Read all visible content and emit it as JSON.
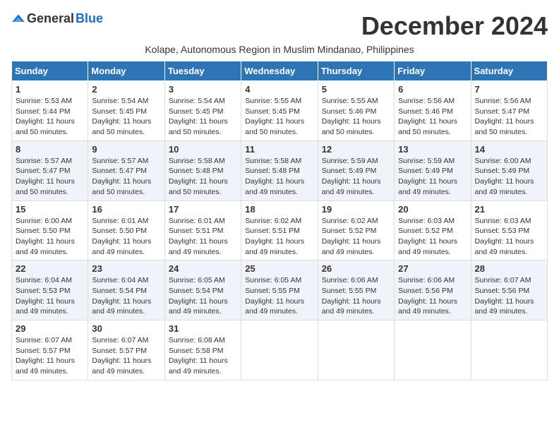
{
  "logo": {
    "general": "General",
    "blue": "Blue"
  },
  "title": "December 2024",
  "subtitle": "Kolape, Autonomous Region in Muslim Mindanao, Philippines",
  "headers": [
    "Sunday",
    "Monday",
    "Tuesday",
    "Wednesday",
    "Thursday",
    "Friday",
    "Saturday"
  ],
  "weeks": [
    [
      {
        "day": "1",
        "info": "Sunrise: 5:53 AM\nSunset: 5:44 PM\nDaylight: 11 hours\nand 50 minutes."
      },
      {
        "day": "2",
        "info": "Sunrise: 5:54 AM\nSunset: 5:45 PM\nDaylight: 11 hours\nand 50 minutes."
      },
      {
        "day": "3",
        "info": "Sunrise: 5:54 AM\nSunset: 5:45 PM\nDaylight: 11 hours\nand 50 minutes."
      },
      {
        "day": "4",
        "info": "Sunrise: 5:55 AM\nSunset: 5:45 PM\nDaylight: 11 hours\nand 50 minutes."
      },
      {
        "day": "5",
        "info": "Sunrise: 5:55 AM\nSunset: 5:46 PM\nDaylight: 11 hours\nand 50 minutes."
      },
      {
        "day": "6",
        "info": "Sunrise: 5:56 AM\nSunset: 5:46 PM\nDaylight: 11 hours\nand 50 minutes."
      },
      {
        "day": "7",
        "info": "Sunrise: 5:56 AM\nSunset: 5:47 PM\nDaylight: 11 hours\nand 50 minutes."
      }
    ],
    [
      {
        "day": "8",
        "info": "Sunrise: 5:57 AM\nSunset: 5:47 PM\nDaylight: 11 hours\nand 50 minutes."
      },
      {
        "day": "9",
        "info": "Sunrise: 5:57 AM\nSunset: 5:47 PM\nDaylight: 11 hours\nand 50 minutes."
      },
      {
        "day": "10",
        "info": "Sunrise: 5:58 AM\nSunset: 5:48 PM\nDaylight: 11 hours\nand 50 minutes."
      },
      {
        "day": "11",
        "info": "Sunrise: 5:58 AM\nSunset: 5:48 PM\nDaylight: 11 hours\nand 49 minutes."
      },
      {
        "day": "12",
        "info": "Sunrise: 5:59 AM\nSunset: 5:49 PM\nDaylight: 11 hours\nand 49 minutes."
      },
      {
        "day": "13",
        "info": "Sunrise: 5:59 AM\nSunset: 5:49 PM\nDaylight: 11 hours\nand 49 minutes."
      },
      {
        "day": "14",
        "info": "Sunrise: 6:00 AM\nSunset: 5:49 PM\nDaylight: 11 hours\nand 49 minutes."
      }
    ],
    [
      {
        "day": "15",
        "info": "Sunrise: 6:00 AM\nSunset: 5:50 PM\nDaylight: 11 hours\nand 49 minutes."
      },
      {
        "day": "16",
        "info": "Sunrise: 6:01 AM\nSunset: 5:50 PM\nDaylight: 11 hours\nand 49 minutes."
      },
      {
        "day": "17",
        "info": "Sunrise: 6:01 AM\nSunset: 5:51 PM\nDaylight: 11 hours\nand 49 minutes."
      },
      {
        "day": "18",
        "info": "Sunrise: 6:02 AM\nSunset: 5:51 PM\nDaylight: 11 hours\nand 49 minutes."
      },
      {
        "day": "19",
        "info": "Sunrise: 6:02 AM\nSunset: 5:52 PM\nDaylight: 11 hours\nand 49 minutes."
      },
      {
        "day": "20",
        "info": "Sunrise: 6:03 AM\nSunset: 5:52 PM\nDaylight: 11 hours\nand 49 minutes."
      },
      {
        "day": "21",
        "info": "Sunrise: 6:03 AM\nSunset: 5:53 PM\nDaylight: 11 hours\nand 49 minutes."
      }
    ],
    [
      {
        "day": "22",
        "info": "Sunrise: 6:04 AM\nSunset: 5:53 PM\nDaylight: 11 hours\nand 49 minutes."
      },
      {
        "day": "23",
        "info": "Sunrise: 6:04 AM\nSunset: 5:54 PM\nDaylight: 11 hours\nand 49 minutes."
      },
      {
        "day": "24",
        "info": "Sunrise: 6:05 AM\nSunset: 5:54 PM\nDaylight: 11 hours\nand 49 minutes."
      },
      {
        "day": "25",
        "info": "Sunrise: 6:05 AM\nSunset: 5:55 PM\nDaylight: 11 hours\nand 49 minutes."
      },
      {
        "day": "26",
        "info": "Sunrise: 6:06 AM\nSunset: 5:55 PM\nDaylight: 11 hours\nand 49 minutes."
      },
      {
        "day": "27",
        "info": "Sunrise: 6:06 AM\nSunset: 5:56 PM\nDaylight: 11 hours\nand 49 minutes."
      },
      {
        "day": "28",
        "info": "Sunrise: 6:07 AM\nSunset: 5:56 PM\nDaylight: 11 hours\nand 49 minutes."
      }
    ],
    [
      {
        "day": "29",
        "info": "Sunrise: 6:07 AM\nSunset: 5:57 PM\nDaylight: 11 hours\nand 49 minutes."
      },
      {
        "day": "30",
        "info": "Sunrise: 6:07 AM\nSunset: 5:57 PM\nDaylight: 11 hours\nand 49 minutes."
      },
      {
        "day": "31",
        "info": "Sunrise: 6:08 AM\nSunset: 5:58 PM\nDaylight: 11 hours\nand 49 minutes."
      },
      {
        "day": "",
        "info": ""
      },
      {
        "day": "",
        "info": ""
      },
      {
        "day": "",
        "info": ""
      },
      {
        "day": "",
        "info": ""
      }
    ]
  ]
}
